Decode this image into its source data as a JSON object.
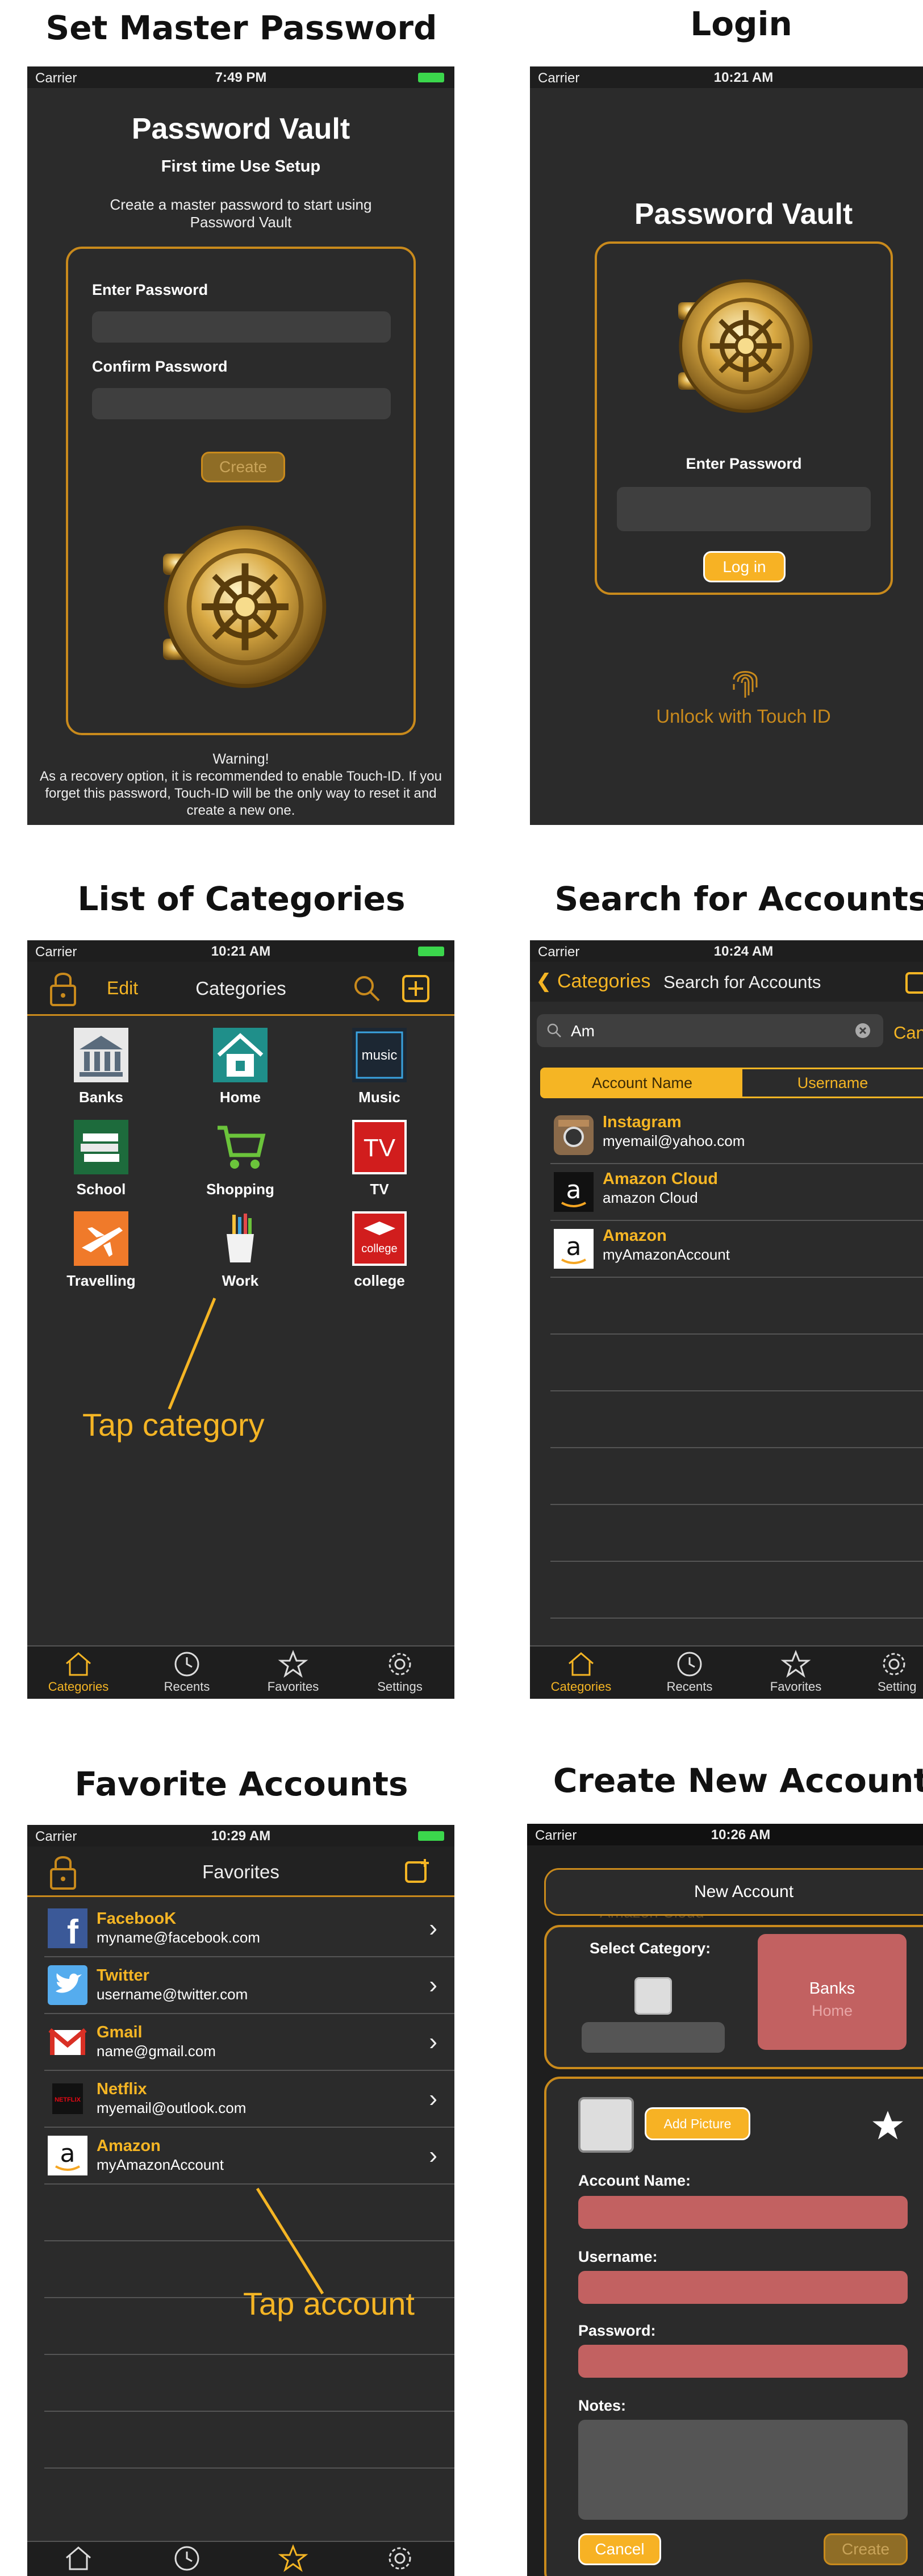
{
  "titles": {
    "set_master": "Set Master Password",
    "login": "Login",
    "categories": "List of Categories",
    "search": "Search for Accounts",
    "favorites": "Favorite Accounts",
    "create": "Create New Account"
  },
  "status": {
    "carrier": "Carrier",
    "time_setup": "7:49 PM",
    "time_login": "10:21 AM",
    "time_categories": "10:21 AM",
    "time_search": "10:24 AM",
    "time_favorites": "10:29 AM",
    "time_create": "10:26 AM"
  },
  "setup": {
    "app_title": "Password Vault",
    "subtitle": "First time Use Setup",
    "instructions": "Create a master password to start using Password Vault",
    "enter_password_label": "Enter Password",
    "confirm_password_label": "Confirm Password",
    "create_button": "Create",
    "warning_title": "Warning!",
    "warning_text": "As a recovery option, it is recommended to enable Touch-ID. If you forget this password, Touch-ID will be the only way to reset it and create a new one."
  },
  "login": {
    "app_title": "Password Vault",
    "enter_password_label": "Enter Password",
    "login_button": "Log in",
    "touch_id_label": "Unlock with Touch ID"
  },
  "categories": {
    "edit": "Edit",
    "nav_title": "Categories",
    "items": [
      {
        "name": "Banks"
      },
      {
        "name": "Home"
      },
      {
        "name": "Music"
      },
      {
        "name": "School"
      },
      {
        "name": "Shopping"
      },
      {
        "name": "TV"
      },
      {
        "name": "Travelling"
      },
      {
        "name": "Work"
      },
      {
        "name": "college"
      }
    ],
    "icon_text_music": "music",
    "icon_text_tv": "TV",
    "icon_text_college": "college",
    "annotation": "Tap category"
  },
  "tabs": {
    "categories": "Categories",
    "recents": "Recents",
    "favorites": "Favorites",
    "settings": "Settings",
    "settings_cut": "Setting"
  },
  "search": {
    "back_label": "Categories",
    "nav_title": "Search for Accounts",
    "query": "Am",
    "cancel_cut": "Canc",
    "seg_account": "Account Name",
    "seg_username": "Username",
    "results": [
      {
        "name": "Instagram",
        "sub": "myemail@yahoo.com"
      },
      {
        "name": "Amazon Cloud",
        "sub": "amazon Cloud"
      },
      {
        "name": "Amazon",
        "sub": "myAmazonAccount"
      }
    ]
  },
  "favorites": {
    "nav_title": "Favorites",
    "rows": [
      {
        "name": "FacebooK",
        "sub": "myname@facebook.com"
      },
      {
        "name": "Twitter",
        "sub": "username@twitter.com"
      },
      {
        "name": "Gmail",
        "sub": "name@gmail.com"
      },
      {
        "name": "Netflix",
        "sub": "myemail@outlook.com"
      },
      {
        "name": "Amazon",
        "sub": "myAmazonAccount"
      }
    ],
    "netflix_logo_text": "NETFLIX",
    "annotation": "Tap account"
  },
  "create": {
    "sheet_title": "New Account",
    "bg_hint": "Amazon Cloud",
    "select_category": "Select Category:",
    "picker_selected": "Banks",
    "picker_next": "Home",
    "add_picture": "Add Picture",
    "account_name_label": "Account Name:",
    "username_label": "Username:",
    "password_label": "Password:",
    "notes_label": "Notes:",
    "cancel": "Cancel",
    "create": "Create"
  },
  "colors": {
    "accent": "#f5b524",
    "border_gold": "#c98a1c",
    "background_dark": "#2b2b2b",
    "field_pink": "#c26161"
  }
}
